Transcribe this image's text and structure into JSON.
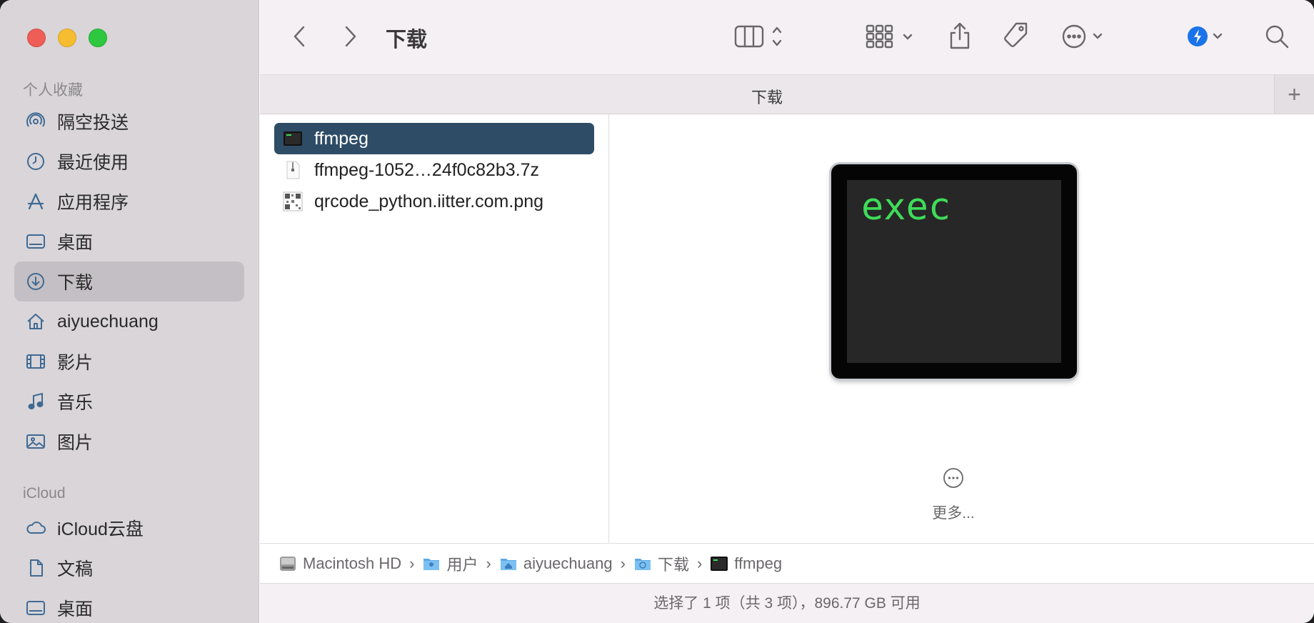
{
  "window": {
    "title": "下载"
  },
  "sidebar": {
    "favorites_title": "个人收藏",
    "favorites": [
      {
        "label": "隔空投送",
        "icon": "airdrop-icon"
      },
      {
        "label": "最近使用",
        "icon": "clock-icon"
      },
      {
        "label": "应用程序",
        "icon": "applications-icon"
      },
      {
        "label": "桌面",
        "icon": "desktop-icon"
      },
      {
        "label": "下载",
        "icon": "download-icon",
        "active": true
      },
      {
        "label": "aiyuechuang",
        "icon": "home-icon"
      },
      {
        "label": "影片",
        "icon": "film-icon"
      },
      {
        "label": "音乐",
        "icon": "music-icon"
      },
      {
        "label": "图片",
        "icon": "photo-icon"
      }
    ],
    "icloud_title": "iCloud",
    "icloud": [
      {
        "label": "iCloud云盘",
        "icon": "cloud-icon"
      },
      {
        "label": "文稿",
        "icon": "document-icon"
      },
      {
        "label": "桌面",
        "icon": "desktop-icon"
      }
    ]
  },
  "tab": {
    "title": "下载",
    "add": "+"
  },
  "files": [
    {
      "name": "ffmpeg",
      "type": "exec",
      "selected": true
    },
    {
      "name": "ffmpeg-1052…24f0c82b3.7z",
      "type": "archive",
      "selected": false
    },
    {
      "name": "qrcode_python.iitter.com.png",
      "type": "image",
      "selected": false
    }
  ],
  "preview": {
    "icon_text": "exec",
    "more_label": "更多..."
  },
  "pathbar": [
    {
      "label": "Macintosh HD",
      "icon": "hard-drive-icon"
    },
    {
      "label": "用户",
      "icon": "users-folder-icon"
    },
    {
      "label": "aiyuechuang",
      "icon": "home-folder-icon"
    },
    {
      "label": "下载",
      "icon": "downloads-folder-icon"
    },
    {
      "label": "ffmpeg",
      "icon": "exec-file-icon"
    }
  ],
  "status": "选择了 1 项（共 3 项），896.77 GB 可用",
  "colors": {
    "selection": "#2e4c66",
    "sidebar_bg": "#d9d5d9",
    "exec_text": "#3fdc59",
    "accent": "#1a73e8"
  }
}
